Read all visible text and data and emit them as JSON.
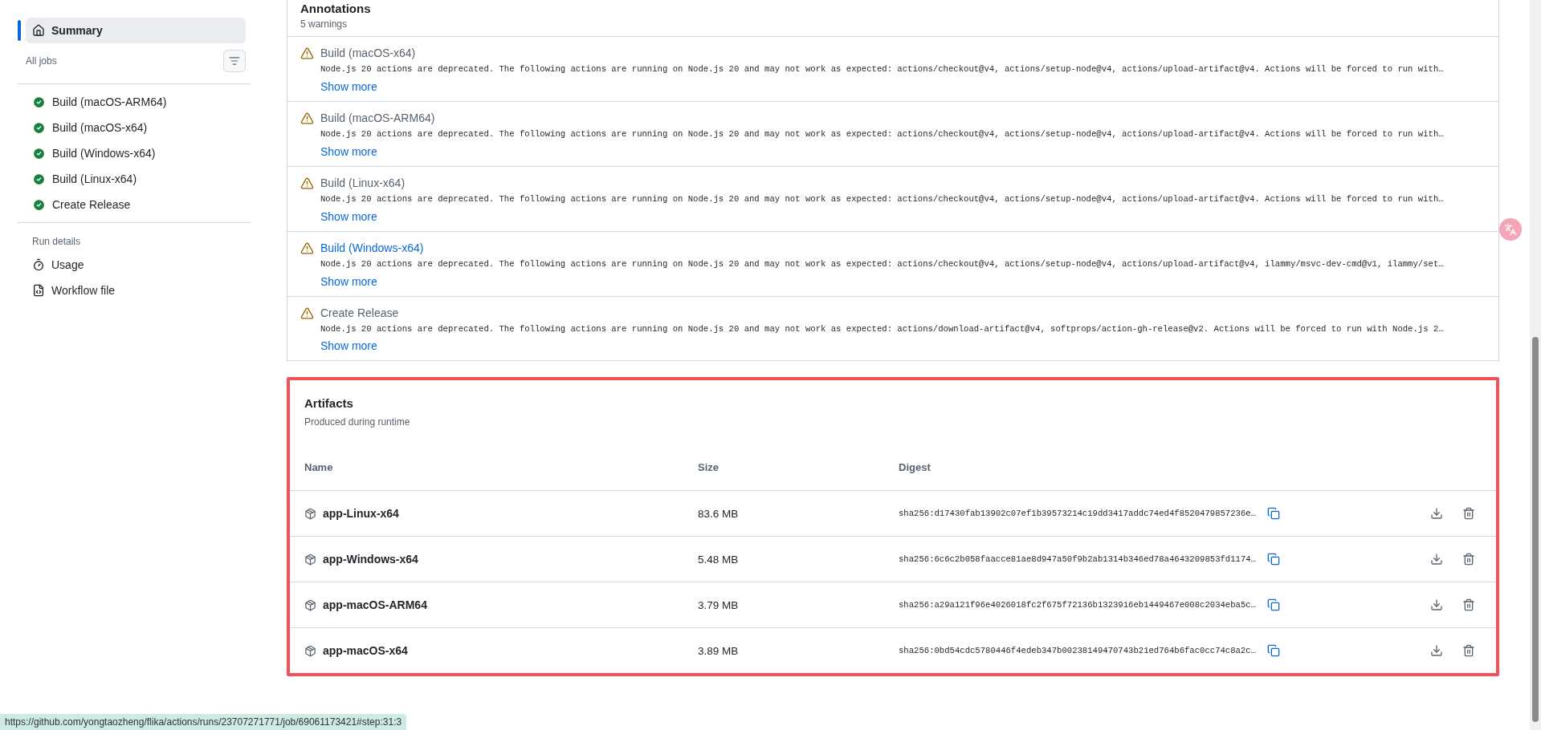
{
  "sidebar": {
    "summary": {
      "label": "Summary",
      "selected": true
    },
    "jobs_heading": "All jobs",
    "jobs": [
      {
        "label": "Build (macOS-ARM64)"
      },
      {
        "label": "Build (macOS-x64)"
      },
      {
        "label": "Build (Windows-x64)"
      },
      {
        "label": "Build (Linux-x64)"
      },
      {
        "label": "Create Release"
      }
    ],
    "run_details_heading": "Run details",
    "run_details": [
      {
        "label": "Usage",
        "kind": "usage"
      },
      {
        "label": "Workflow file",
        "kind": "workflow"
      }
    ]
  },
  "annotations": {
    "title": "Annotations",
    "count": "5 warnings",
    "items": [
      {
        "title": "Build (macOS-x64)",
        "highlighted": false,
        "message": "Node.js 20 actions are deprecated. The following actions are running on Node.js 20 and may not work as expected: actions/checkout@v4, actions/setup-node@v4, actions/upload-artifact@v4. Actions will be forced to run with…",
        "link": "Show more"
      },
      {
        "title": "Build (macOS-ARM64)",
        "highlighted": false,
        "message": "Node.js 20 actions are deprecated. The following actions are running on Node.js 20 and may not work as expected: actions/checkout@v4, actions/setup-node@v4, actions/upload-artifact@v4. Actions will be forced to run with…",
        "link": "Show more"
      },
      {
        "title": "Build (Linux-x64)",
        "highlighted": false,
        "message": "Node.js 20 actions are deprecated. The following actions are running on Node.js 20 and may not work as expected: actions/checkout@v4, actions/setup-node@v4, actions/upload-artifact@v4. Actions will be forced to run with…",
        "link": "Show more"
      },
      {
        "title": "Build (Windows-x64)",
        "highlighted": true,
        "message": "Node.js 20 actions are deprecated. The following actions are running on Node.js 20 and may not work as expected: actions/checkout@v4, actions/setup-node@v4, actions/upload-artifact@v4, ilammy/msvc-dev-cmd@v1, ilammy/set…",
        "link": "Show more"
      },
      {
        "title": "Create Release",
        "highlighted": false,
        "message": "Node.js 20 actions are deprecated. The following actions are running on Node.js 20 and may not work as expected: actions/download-artifact@v4, softprops/action-gh-release@v2. Actions will be forced to run with Node.js 2…",
        "link": "Show more"
      }
    ]
  },
  "artifacts": {
    "title": "Artifacts",
    "subtitle": "Produced during runtime",
    "columns": [
      "Name",
      "Size",
      "Digest"
    ],
    "rows": [
      {
        "name": "app-Linux-x64",
        "size": "83.6 MB",
        "digest": "sha256:d17430fab13902c07ef1b39573214c19dd3417addc74ed4f8520479857236e…"
      },
      {
        "name": "app-Windows-x64",
        "size": "5.48 MB",
        "digest": "sha256:6c6c2b058faacce81ae8d947a50f9b2ab1314b346ed78a4643209853fd1174…"
      },
      {
        "name": "app-macOS-ARM64",
        "size": "3.79 MB",
        "digest": "sha256:a29a121f96e4026018fc2f675f72136b1323916eb1449467e008c2034eba5c…"
      },
      {
        "name": "app-macOS-x64",
        "size": "3.89 MB",
        "digest": "sha256:0bd54cdc5780446f4edeb347b00238149470743b21ed764b6fac0cc74c8a2c…"
      }
    ]
  },
  "status_bar": {
    "url": "https://github.com/yongtaozheng/flika/actions/runs/23707271771/job/69061173421#step:31:3"
  }
}
